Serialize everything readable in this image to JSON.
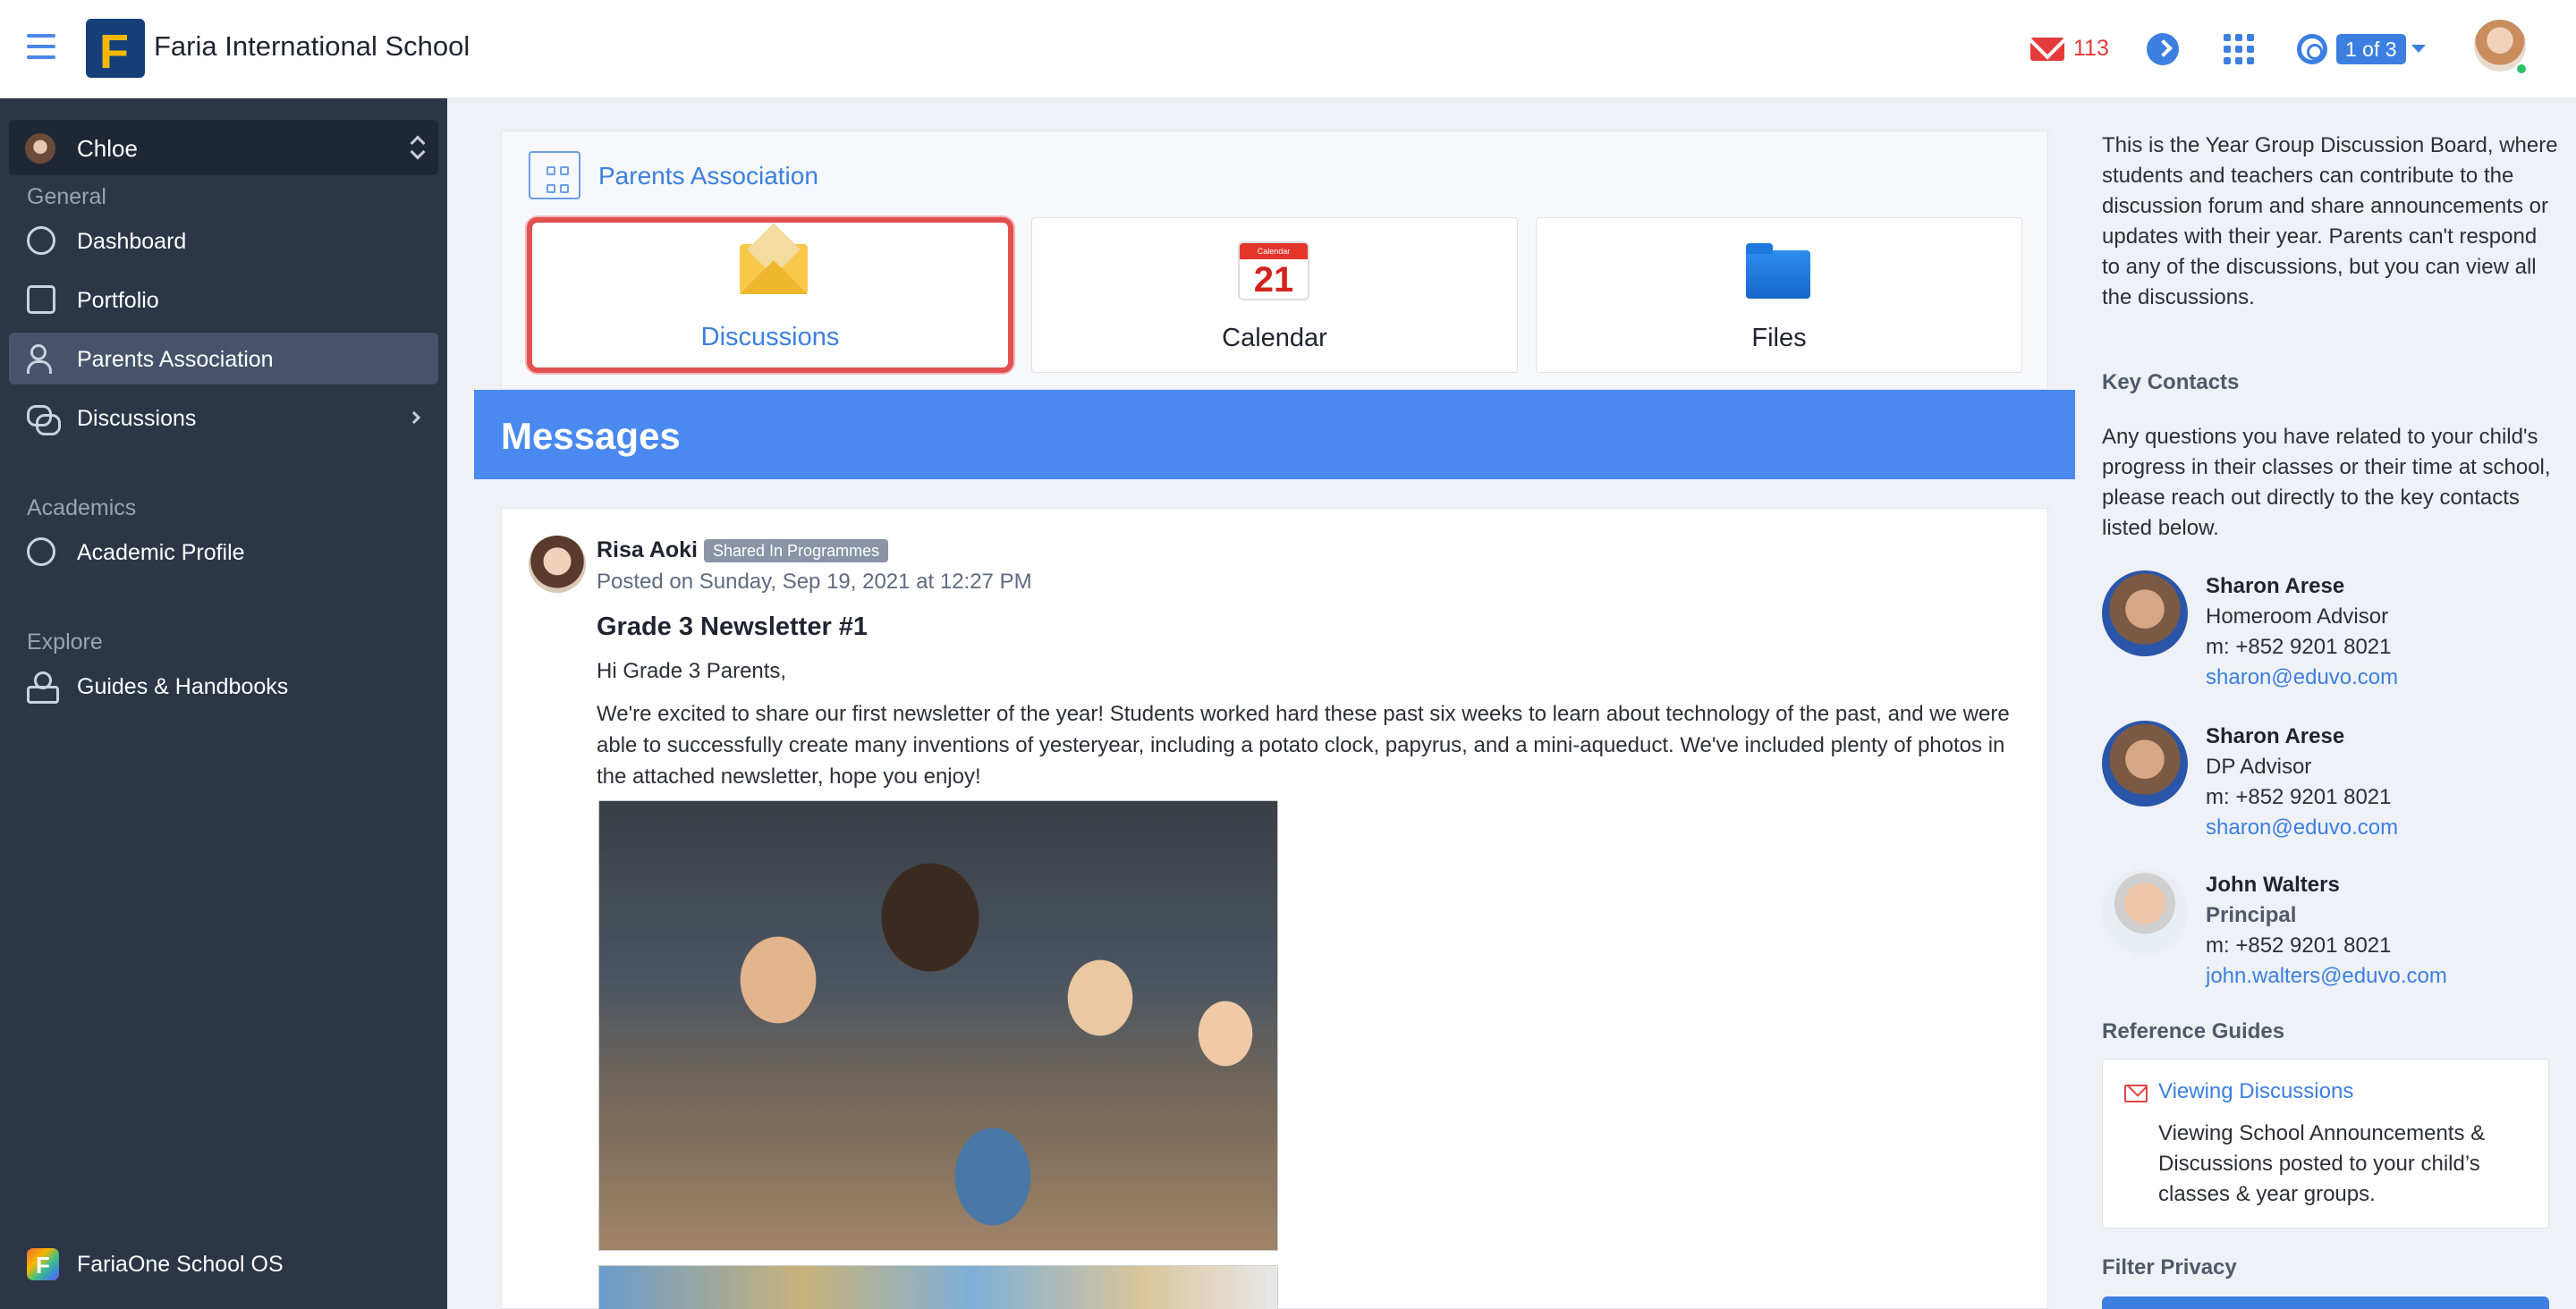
{
  "header": {
    "school_name": "Faria International School",
    "logo_letter": "F",
    "mail_count": "113",
    "pager": "1 of 3"
  },
  "sidebar": {
    "user": "Chloe",
    "sections": [
      {
        "label": "General",
        "items": [
          {
            "label": "Dashboard",
            "icon": "dashboard-icon"
          },
          {
            "label": "Portfolio",
            "icon": "portfolio-icon"
          },
          {
            "label": "Parents Association",
            "icon": "people-icon",
            "active": true
          },
          {
            "label": "Discussions",
            "icon": "discussions-icon",
            "has_submenu": true
          }
        ]
      },
      {
        "label": "Academics",
        "items": [
          {
            "label": "Academic Profile",
            "icon": "academic-profile-icon"
          }
        ]
      },
      {
        "label": "Explore",
        "items": [
          {
            "label": "Guides & Handbooks",
            "icon": "guides-icon"
          }
        ]
      }
    ],
    "footer": "FariaOne School OS"
  },
  "group": {
    "title": "Parents Association",
    "tiles": [
      {
        "label": "Discussions",
        "icon": "envelope-icon",
        "highlighted": true
      },
      {
        "label": "Calendar",
        "icon": "calendar-icon",
        "calendar_header": "Calendar",
        "calendar_day": "21"
      },
      {
        "label": "Files",
        "icon": "folder-icon"
      }
    ]
  },
  "messages": {
    "title": "Messages",
    "post": {
      "author": "Risa Aoki",
      "badge": "Shared In Programmes",
      "posted": "Posted on Sunday, Sep 19, 2021 at 12:27 PM",
      "title": "Grade 3 Newsletter #1",
      "greeting": "Hi Grade 3 Parents,",
      "body": "We're excited to share our first newsletter of the year! Students worked hard these past six weeks to learn about technology of the past, and we were able to successfully create many inventions of yesteryear, including a potato clock, papyrus, and a mini-aqueduct. We've included plenty of photos in the attached newsletter, hope you enjoy!"
    }
  },
  "right_panel": {
    "intro": "This is the Year Group Discussion Board, where students and teachers can contribute to the discussion forum and share announcements or updates with their year. Parents can't respond to any of the discussions, but you can view all the discussions.",
    "key_contacts_heading": "Key Contacts",
    "key_contacts_intro": "Any questions you have related to your child's progress in their classes or their time at school, please reach out directly to the key contacts listed below.",
    "contacts": [
      {
        "name": "Sharon Arese",
        "role": "Homeroom Advisor",
        "phone": "m: +852 9201 8021",
        "email": "sharon@eduvo.com"
      },
      {
        "name": "Sharon Arese",
        "role": "DP Advisor",
        "phone": "m: +852 9201 8021",
        "email": "sharon@eduvo.com"
      },
      {
        "name": "John Walters",
        "role": "Principal",
        "phone": "m: +852 9201 8021",
        "email": "john.walters@eduvo.com"
      }
    ],
    "reference_heading": "Reference Guides",
    "guide": {
      "title": "Viewing Discussions",
      "description": "Viewing School Announcements & Discussions posted to your child’s classes & year groups."
    },
    "filter_heading": "Filter Privacy"
  },
  "colors": {
    "accent": "#3c7fe0",
    "sidebar": "#2c3647",
    "highlight": "#e35050",
    "mail": "#e53a3a"
  }
}
